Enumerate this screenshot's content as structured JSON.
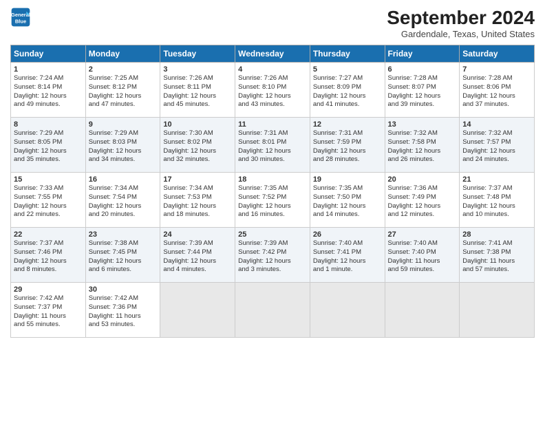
{
  "header": {
    "logo_line1": "General",
    "logo_line2": "Blue",
    "month": "September 2024",
    "location": "Gardendale, Texas, United States"
  },
  "weekdays": [
    "Sunday",
    "Monday",
    "Tuesday",
    "Wednesday",
    "Thursday",
    "Friday",
    "Saturday"
  ],
  "weeks": [
    [
      {
        "day": "1",
        "lines": [
          "Sunrise: 7:24 AM",
          "Sunset: 8:14 PM",
          "Daylight: 12 hours",
          "and 49 minutes."
        ]
      },
      {
        "day": "2",
        "lines": [
          "Sunrise: 7:25 AM",
          "Sunset: 8:12 PM",
          "Daylight: 12 hours",
          "and 47 minutes."
        ]
      },
      {
        "day": "3",
        "lines": [
          "Sunrise: 7:26 AM",
          "Sunset: 8:11 PM",
          "Daylight: 12 hours",
          "and 45 minutes."
        ]
      },
      {
        "day": "4",
        "lines": [
          "Sunrise: 7:26 AM",
          "Sunset: 8:10 PM",
          "Daylight: 12 hours",
          "and 43 minutes."
        ]
      },
      {
        "day": "5",
        "lines": [
          "Sunrise: 7:27 AM",
          "Sunset: 8:09 PM",
          "Daylight: 12 hours",
          "and 41 minutes."
        ]
      },
      {
        "day": "6",
        "lines": [
          "Sunrise: 7:28 AM",
          "Sunset: 8:07 PM",
          "Daylight: 12 hours",
          "and 39 minutes."
        ]
      },
      {
        "day": "7",
        "lines": [
          "Sunrise: 7:28 AM",
          "Sunset: 8:06 PM",
          "Daylight: 12 hours",
          "and 37 minutes."
        ]
      }
    ],
    [
      {
        "day": "8",
        "lines": [
          "Sunrise: 7:29 AM",
          "Sunset: 8:05 PM",
          "Daylight: 12 hours",
          "and 35 minutes."
        ]
      },
      {
        "day": "9",
        "lines": [
          "Sunrise: 7:29 AM",
          "Sunset: 8:03 PM",
          "Daylight: 12 hours",
          "and 34 minutes."
        ]
      },
      {
        "day": "10",
        "lines": [
          "Sunrise: 7:30 AM",
          "Sunset: 8:02 PM",
          "Daylight: 12 hours",
          "and 32 minutes."
        ]
      },
      {
        "day": "11",
        "lines": [
          "Sunrise: 7:31 AM",
          "Sunset: 8:01 PM",
          "Daylight: 12 hours",
          "and 30 minutes."
        ]
      },
      {
        "day": "12",
        "lines": [
          "Sunrise: 7:31 AM",
          "Sunset: 7:59 PM",
          "Daylight: 12 hours",
          "and 28 minutes."
        ]
      },
      {
        "day": "13",
        "lines": [
          "Sunrise: 7:32 AM",
          "Sunset: 7:58 PM",
          "Daylight: 12 hours",
          "and 26 minutes."
        ]
      },
      {
        "day": "14",
        "lines": [
          "Sunrise: 7:32 AM",
          "Sunset: 7:57 PM",
          "Daylight: 12 hours",
          "and 24 minutes."
        ]
      }
    ],
    [
      {
        "day": "15",
        "lines": [
          "Sunrise: 7:33 AM",
          "Sunset: 7:55 PM",
          "Daylight: 12 hours",
          "and 22 minutes."
        ]
      },
      {
        "day": "16",
        "lines": [
          "Sunrise: 7:34 AM",
          "Sunset: 7:54 PM",
          "Daylight: 12 hours",
          "and 20 minutes."
        ]
      },
      {
        "day": "17",
        "lines": [
          "Sunrise: 7:34 AM",
          "Sunset: 7:53 PM",
          "Daylight: 12 hours",
          "and 18 minutes."
        ]
      },
      {
        "day": "18",
        "lines": [
          "Sunrise: 7:35 AM",
          "Sunset: 7:52 PM",
          "Daylight: 12 hours",
          "and 16 minutes."
        ]
      },
      {
        "day": "19",
        "lines": [
          "Sunrise: 7:35 AM",
          "Sunset: 7:50 PM",
          "Daylight: 12 hours",
          "and 14 minutes."
        ]
      },
      {
        "day": "20",
        "lines": [
          "Sunrise: 7:36 AM",
          "Sunset: 7:49 PM",
          "Daylight: 12 hours",
          "and 12 minutes."
        ]
      },
      {
        "day": "21",
        "lines": [
          "Sunrise: 7:37 AM",
          "Sunset: 7:48 PM",
          "Daylight: 12 hours",
          "and 10 minutes."
        ]
      }
    ],
    [
      {
        "day": "22",
        "lines": [
          "Sunrise: 7:37 AM",
          "Sunset: 7:46 PM",
          "Daylight: 12 hours",
          "and 8 minutes."
        ]
      },
      {
        "day": "23",
        "lines": [
          "Sunrise: 7:38 AM",
          "Sunset: 7:45 PM",
          "Daylight: 12 hours",
          "and 6 minutes."
        ]
      },
      {
        "day": "24",
        "lines": [
          "Sunrise: 7:39 AM",
          "Sunset: 7:44 PM",
          "Daylight: 12 hours",
          "and 4 minutes."
        ]
      },
      {
        "day": "25",
        "lines": [
          "Sunrise: 7:39 AM",
          "Sunset: 7:42 PM",
          "Daylight: 12 hours",
          "and 3 minutes."
        ]
      },
      {
        "day": "26",
        "lines": [
          "Sunrise: 7:40 AM",
          "Sunset: 7:41 PM",
          "Daylight: 12 hours",
          "and 1 minute."
        ]
      },
      {
        "day": "27",
        "lines": [
          "Sunrise: 7:40 AM",
          "Sunset: 7:40 PM",
          "Daylight: 11 hours",
          "and 59 minutes."
        ]
      },
      {
        "day": "28",
        "lines": [
          "Sunrise: 7:41 AM",
          "Sunset: 7:38 PM",
          "Daylight: 11 hours",
          "and 57 minutes."
        ]
      }
    ],
    [
      {
        "day": "29",
        "lines": [
          "Sunrise: 7:42 AM",
          "Sunset: 7:37 PM",
          "Daylight: 11 hours",
          "and 55 minutes."
        ]
      },
      {
        "day": "30",
        "lines": [
          "Sunrise: 7:42 AM",
          "Sunset: 7:36 PM",
          "Daylight: 11 hours",
          "and 53 minutes."
        ]
      },
      null,
      null,
      null,
      null,
      null
    ]
  ]
}
